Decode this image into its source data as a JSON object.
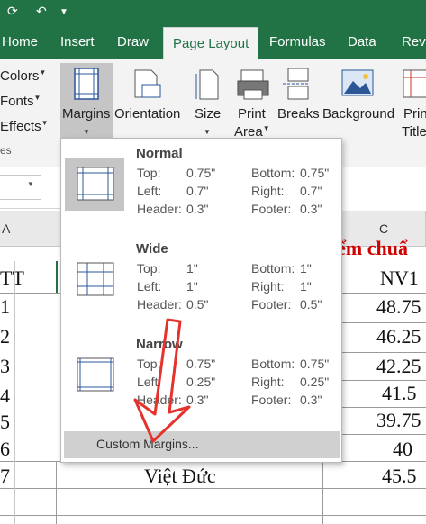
{
  "tabs": [
    "Home",
    "Insert",
    "Draw",
    "Page Layout",
    "Formulas",
    "Data",
    "Revi"
  ],
  "ribbon": {
    "theme_items": [
      "Colors",
      "Fonts",
      "Effects",
      "es"
    ],
    "buttons": {
      "margins": "Margins",
      "orientation": "Orientation",
      "size": "Size",
      "print_area_1": "Print",
      "print_area_2": "Area",
      "breaks": "Breaks",
      "background": "Background",
      "print_titles_1": "Prin",
      "print_titles_2": "Title"
    }
  },
  "margins_menu": {
    "options": [
      {
        "name": "Normal",
        "top": "0.75\"",
        "bottom": "0.75\"",
        "left": "0.7\"",
        "right": "0.7\"",
        "header": "0.3\"",
        "footer": "0.3\""
      },
      {
        "name": "Wide",
        "top": "1\"",
        "bottom": "1\"",
        "left": "1\"",
        "right": "1\"",
        "header": "0.5\"",
        "footer": "0.5\""
      },
      {
        "name": "Narrow",
        "top": "0.75\"",
        "bottom": "0.75\"",
        "left": "0.25\"",
        "right": "0.25\"",
        "header": "0.3\"",
        "footer": "0.3\""
      }
    ],
    "labels": {
      "top": "Top:",
      "bottom": "Bottom:",
      "left": "Left:",
      "right": "Right:",
      "header": "Header:",
      "footer": "Footer:"
    },
    "custom": "Custom Margins..."
  },
  "sheet": {
    "col_a": "A",
    "col_c": "C",
    "heading_red": "iểm chuẩ",
    "heading_red_color": "#d00000",
    "stt": "TT",
    "rows": [
      "1",
      "2",
      "3",
      "4",
      "5",
      "6",
      "7"
    ],
    "col_c_values": [
      "NV1",
      "48.75",
      "46.25",
      "42.25",
      "41.5",
      "39.75",
      "40",
      "45.5"
    ],
    "school": "Việt Đức"
  },
  "colors": {
    "excel_green": "#217346"
  }
}
